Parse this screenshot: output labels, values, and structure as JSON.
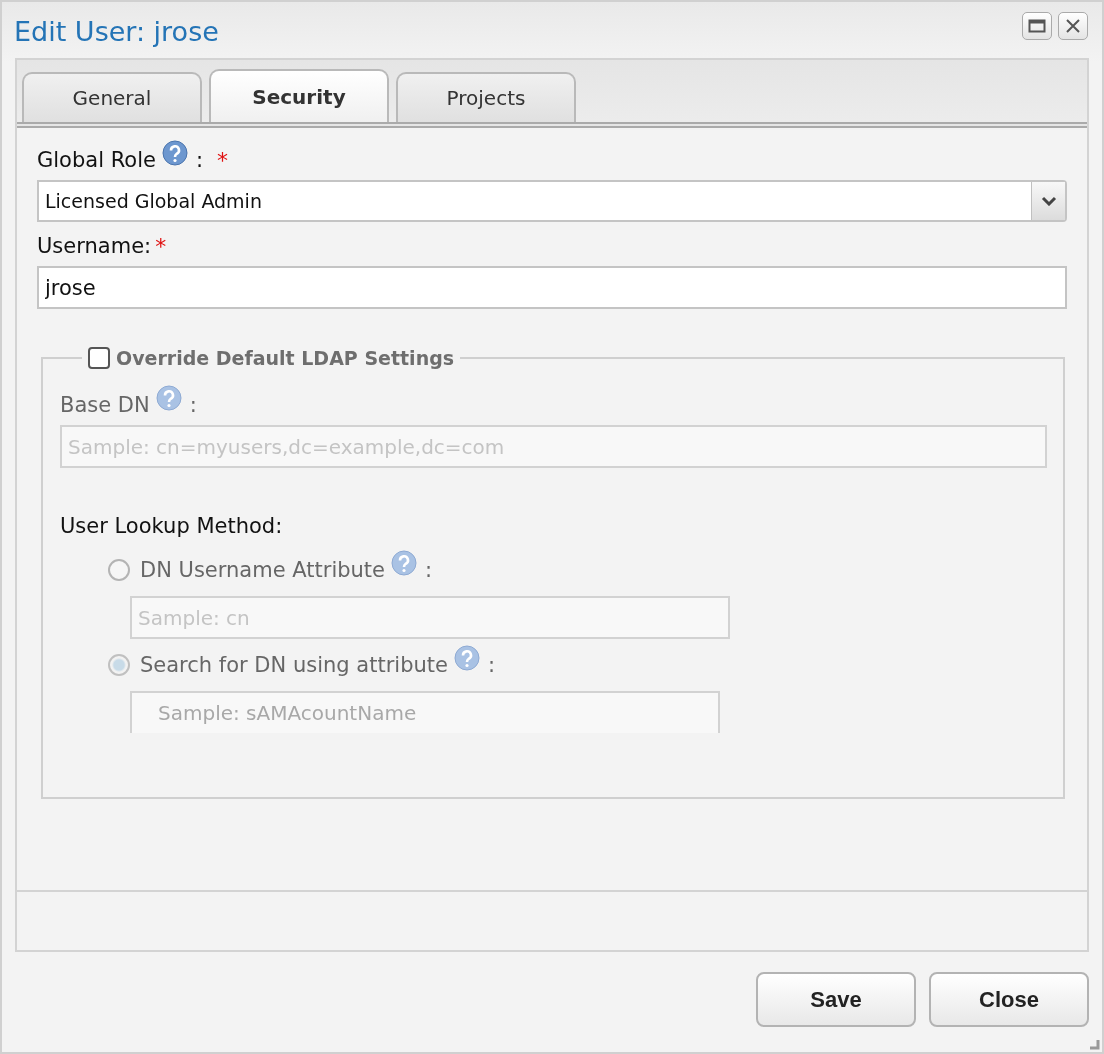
{
  "window": {
    "title": "Edit User: jrose"
  },
  "tabs": [
    {
      "label": "General",
      "selected": false
    },
    {
      "label": "Security",
      "selected": true
    },
    {
      "label": "Projects",
      "selected": false
    }
  ],
  "global_role": {
    "label": "Global Role",
    "colon": ":",
    "required_mark": "*",
    "value": "Licensed Global Admin"
  },
  "username": {
    "label": "Username:",
    "required_mark": "*",
    "value": "jrose"
  },
  "ldap": {
    "legend": "Override Default LDAP Settings",
    "checked": false,
    "disabled": true,
    "base_dn": {
      "label": "Base DN",
      "colon": ":",
      "placeholder": "Sample: cn=myusers,dc=example,dc=com"
    },
    "lookup_label": "User Lookup Method:",
    "options": [
      {
        "label": "DN Username Attribute",
        "colon": ":",
        "selected": false,
        "placeholder": "Sample: cn"
      },
      {
        "label": "Search for DN using attribute",
        "colon": ":",
        "selected": true,
        "placeholder": "Sample: sAMAcountName"
      }
    ]
  },
  "buttons": [
    "Save",
    "Close"
  ]
}
